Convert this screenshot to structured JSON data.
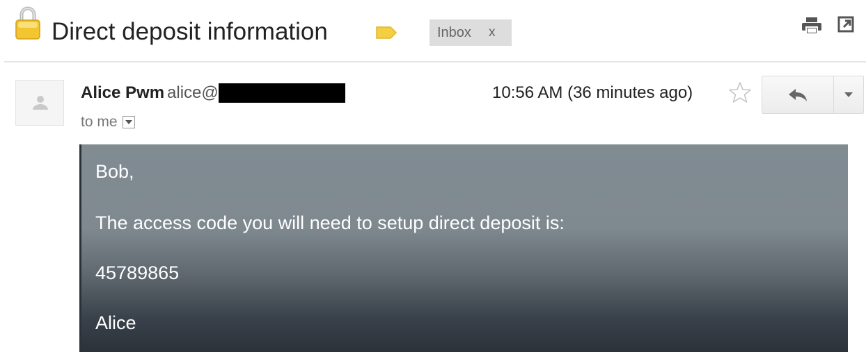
{
  "thread": {
    "subject": "Direct deposit information",
    "label_chip": "Inbox",
    "label_chip_remove": "x"
  },
  "message": {
    "sender_name": "Alice Pwm",
    "sender_email_prefix": "alice@",
    "recipient": "to me",
    "timestamp": "10:56 AM (36 minutes ago)"
  },
  "body": {
    "greeting": "Bob,",
    "line": "The access code you will need to setup direct deposit is:",
    "code": "45789865",
    "signature": "Alice"
  },
  "icons": {
    "lock": "lock-icon",
    "label": "label-tag-icon",
    "print": "print-icon",
    "popout": "popout-icon",
    "avatar": "person-icon",
    "star": "star-icon",
    "reply": "reply-icon",
    "more": "chevron-down-icon"
  },
  "colors": {
    "lock": "#f2c531",
    "label_tag": "#f4cf40",
    "chip_bg": "#dddddd",
    "body_top": "#818b92",
    "body_bottom": "#2b323a"
  }
}
